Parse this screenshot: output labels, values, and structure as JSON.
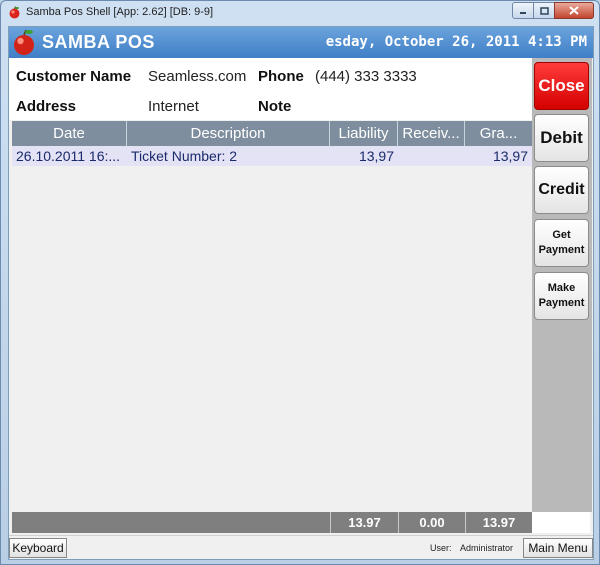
{
  "window": {
    "title": "Samba Pos Shell [App: 2.62] [DB: 9-9]"
  },
  "header": {
    "brand": "SAMBA POS",
    "clock": "esday, October 26, 2011 4:13 PM",
    "color": "#4a8bd0"
  },
  "customer": {
    "name_label": "Customer Name",
    "name_value": "Seamless.com",
    "phone_label": "Phone",
    "phone_value": "(444) 333 3333",
    "address_label": "Address",
    "address_value": "Internet",
    "note_label": "Note"
  },
  "grid": {
    "columns": [
      "Date",
      "Description",
      "Liability",
      "Receiv...",
      "Gra..."
    ],
    "rows": [
      {
        "date": "26.10.2011 16:...",
        "description": "Ticket Number: 2",
        "liability": "13,97",
        "receivable": "",
        "grand": "13,97"
      }
    ]
  },
  "totals": {
    "liability": "13.97",
    "receivable": "0.00",
    "grand": "13.97"
  },
  "actions": {
    "close": "Close",
    "debit": "Debit",
    "credit": "Credit",
    "get_payment_line1": "Get",
    "get_payment_line2": "Payment",
    "make_payment_line1": "Make",
    "make_payment_line2": "Payment",
    "close_color": "#e00000"
  },
  "statusbar": {
    "keyboard": "Keyboard",
    "user_label": "User:",
    "user_name": "Administrator",
    "main_menu": "Main Menu"
  }
}
